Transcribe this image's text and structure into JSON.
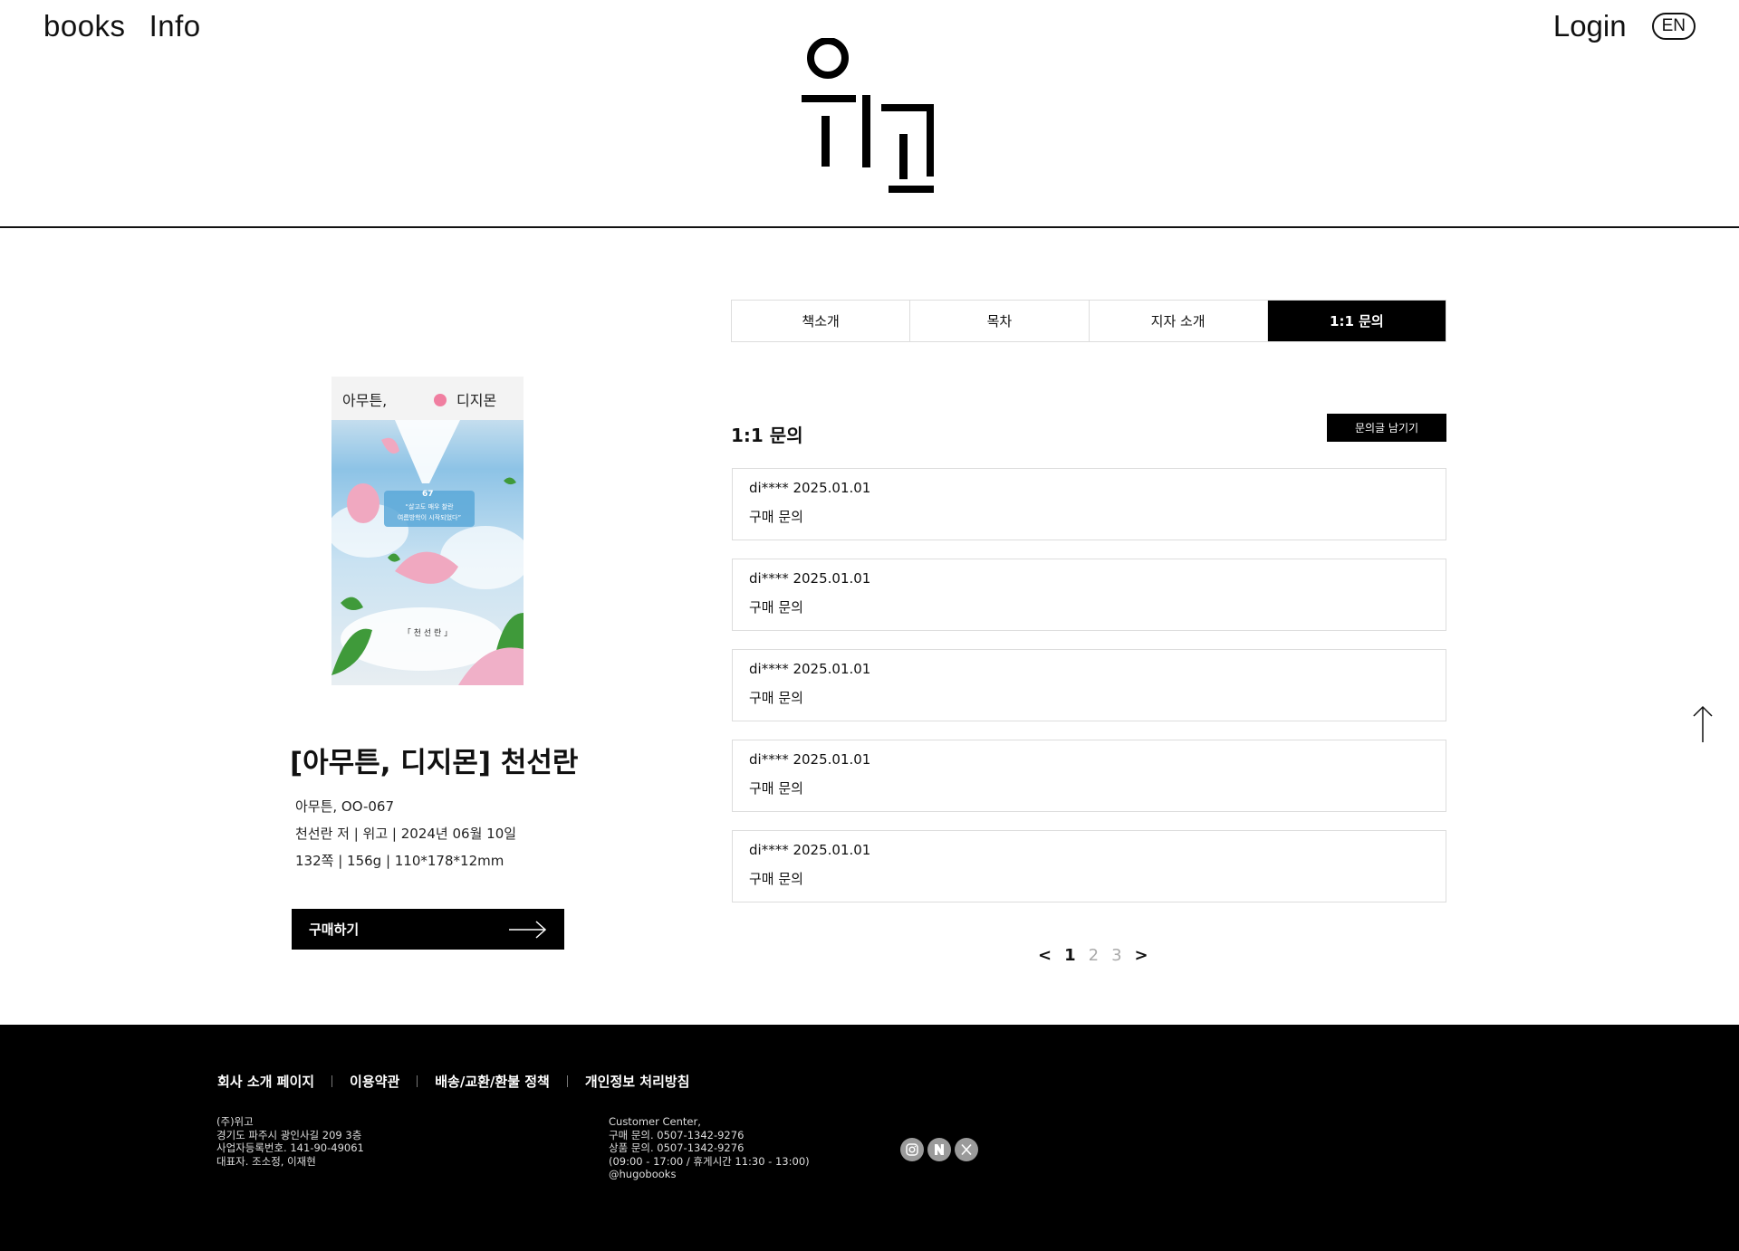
{
  "header": {
    "nav": [
      "books",
      "Info"
    ],
    "login": "Login",
    "lang": "EN",
    "logo_name": "위고"
  },
  "book": {
    "cover_title_left": "아무튼,",
    "cover_title_right": "디지몬",
    "cover_number": "67",
    "cover_quote_1": "“살고도 매우 찰란",
    "cover_quote_2": "여름방학이 시작되었다”",
    "cover_author": "「 천 선 란 」",
    "title": "[아무튼, 디지몬] 천선란",
    "series": "아무튼, OO-067",
    "pub": "천선란 저 | 위고 | 2024년 06월 10일",
    "spec": "132쪽 | 156g | 110*178*12mm",
    "buy_label": "구매하기"
  },
  "tabs": [
    "책소개",
    "목차",
    "지자 소개",
    "1:1 문의"
  ],
  "active_tab": 3,
  "inquiry": {
    "title": "1:1 문의",
    "write_button": "문의글 남기기",
    "items": [
      {
        "meta": "di**** 2025.01.01",
        "subject": "구매 문의"
      },
      {
        "meta": "di**** 2025.01.01",
        "subject": "구매 문의"
      },
      {
        "meta": "di**** 2025.01.01",
        "subject": "구매 문의"
      },
      {
        "meta": "di**** 2025.01.01",
        "subject": "구매 문의"
      },
      {
        "meta": "di**** 2025.01.01",
        "subject": "구매 문의"
      }
    ]
  },
  "pager": {
    "prev": "<",
    "pages": [
      "1",
      "2",
      "3"
    ],
    "current": "1",
    "next": ">"
  },
  "footer": {
    "links": [
      "회사 소개 페이지",
      "이용약관",
      "배송/교환/환불 정책",
      "개인정보 처리방침"
    ],
    "company": [
      "(주)위고",
      "경기도 파주시 광인사길 209 3층",
      "사업자등록번호. 141-90-49061",
      "대표자. 조소정, 이재현"
    ],
    "customer": [
      "Customer Center,",
      "구매 문의. 0507-1342-9276",
      "상품 문의. 0507-1342-9276",
      "(09:00 - 17:00 / 휴게시간 11:30 - 13:00)",
      "@hugobooks"
    ],
    "social_icons": [
      "instagram-icon",
      "naver-icon",
      "x-icon"
    ]
  }
}
